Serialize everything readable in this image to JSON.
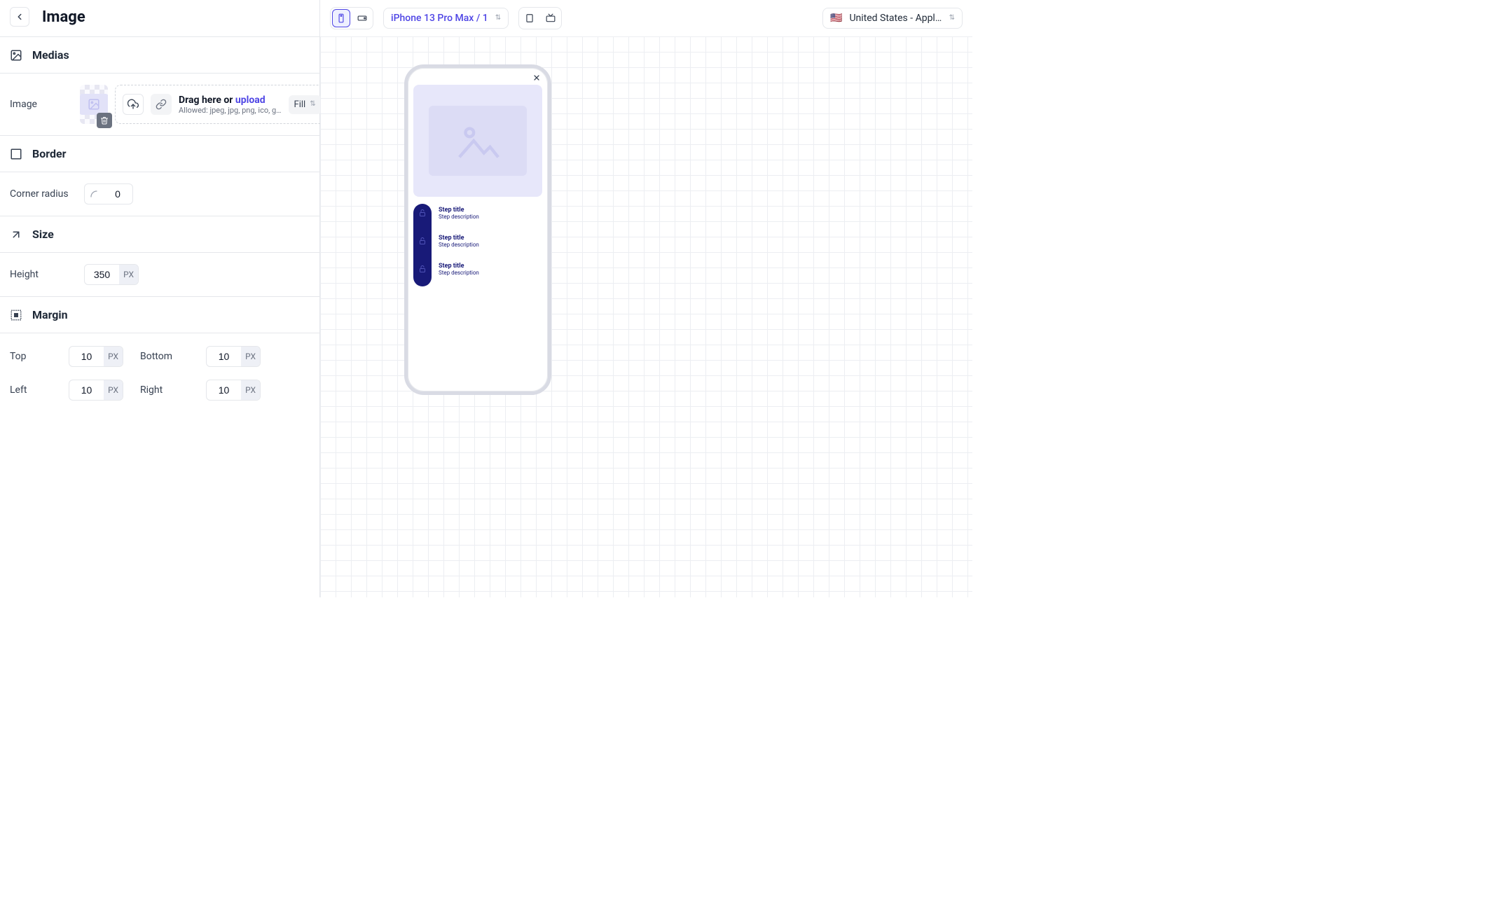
{
  "header": {
    "title": "Image"
  },
  "sections": {
    "medias": "Medias",
    "border": "Border",
    "size": "Size",
    "margin": "Margin"
  },
  "image_row": {
    "label": "Image",
    "drag_text": "Drag here or ",
    "upload_text": "upload",
    "allowed_text": "Allowed: jpeg, jpg, png, ico, g…",
    "fill_mode": "Fill"
  },
  "border_row": {
    "label": "Corner radius",
    "value": "0"
  },
  "size_row": {
    "label": "Height",
    "value": "350",
    "unit": "PX"
  },
  "margin": {
    "top_label": "Top",
    "top_value": "10",
    "top_unit": "PX",
    "bottom_label": "Bottom",
    "bottom_value": "10",
    "bottom_unit": "PX",
    "left_label": "Left",
    "left_value": "10",
    "left_unit": "PX",
    "right_label": "Right",
    "right_value": "10",
    "right_unit": "PX"
  },
  "toolbar": {
    "device_text": "iPhone 13 Pro Max / 1",
    "store_text": "United States - Apple …",
    "flag": "🇺🇸"
  },
  "preview": {
    "steps": [
      {
        "title": "Step title",
        "desc": "Step description"
      },
      {
        "title": "Step title",
        "desc": "Step description"
      },
      {
        "title": "Step title",
        "desc": "Step description"
      }
    ]
  }
}
